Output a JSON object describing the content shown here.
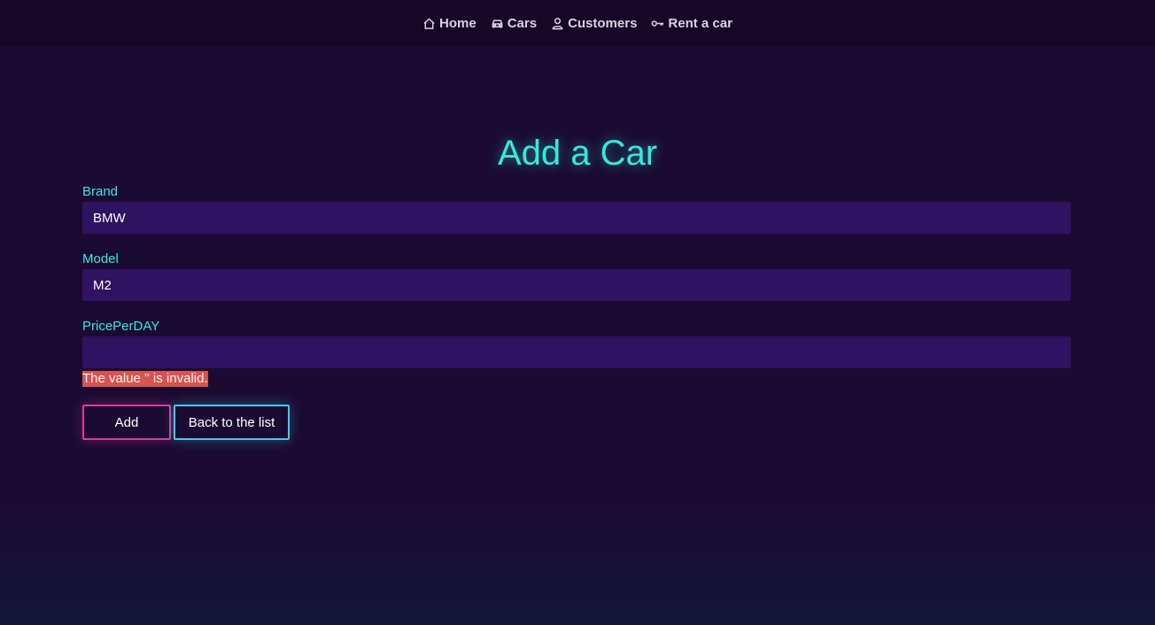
{
  "nav": {
    "items": [
      {
        "label": "Home",
        "icon": "home-icon"
      },
      {
        "label": "Cars",
        "icon": "car-icon"
      },
      {
        "label": "Customers",
        "icon": "user-icon"
      },
      {
        "label": "Rent a car",
        "icon": "key-icon"
      }
    ]
  },
  "page": {
    "title": "Add a Car"
  },
  "form": {
    "brand": {
      "label": "Brand",
      "value": "BMW"
    },
    "model": {
      "label": "Model",
      "value": "M2"
    },
    "price": {
      "label": "PricePerDAY",
      "value": ""
    },
    "price_error": "The value '' is invalid.",
    "add_label": "Add",
    "back_label": "Back to the list"
  },
  "colors": {
    "accent_cyan": "#33ead9",
    "accent_pink": "#e0399f",
    "input_bg": "#2f1261",
    "error_bg": "#d9534f"
  }
}
